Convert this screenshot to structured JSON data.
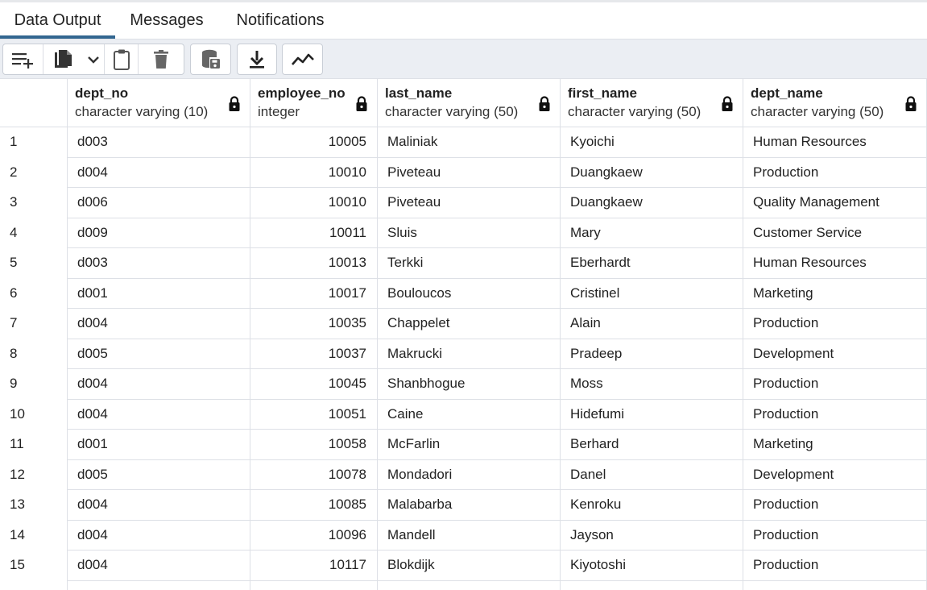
{
  "tabs": [
    {
      "label": "Data Output",
      "active": true
    },
    {
      "label": "Messages",
      "active": false
    },
    {
      "label": "Notifications",
      "active": false
    }
  ],
  "toolbar": {
    "buttons": [
      {
        "icon": "add-row-icon"
      },
      {
        "icon": "copy-icon"
      },
      {
        "icon": "chevron-down-icon"
      },
      {
        "icon": "paste-icon"
      },
      {
        "icon": "delete-icon"
      },
      {
        "icon": "save-data-icon"
      },
      {
        "icon": "download-icon"
      },
      {
        "icon": "graph-icon"
      }
    ],
    "accent_color": "#326690"
  },
  "columns": [
    {
      "name": "dept_no",
      "type": "character varying (10)"
    },
    {
      "name": "employee_no",
      "type": "integer"
    },
    {
      "name": "last_name",
      "type": "character varying (50)"
    },
    {
      "name": "first_name",
      "type": "character varying (50)"
    },
    {
      "name": "dept_name",
      "type": "character varying (50)"
    }
  ],
  "rows": [
    {
      "n": "1",
      "dept_no": "d003",
      "employee_no": "10005",
      "last_name": "Maliniak",
      "first_name": "Kyoichi",
      "dept_name": "Human Resources"
    },
    {
      "n": "2",
      "dept_no": "d004",
      "employee_no": "10010",
      "last_name": "Piveteau",
      "first_name": "Duangkaew",
      "dept_name": "Production"
    },
    {
      "n": "3",
      "dept_no": "d006",
      "employee_no": "10010",
      "last_name": "Piveteau",
      "first_name": "Duangkaew",
      "dept_name": "Quality Management"
    },
    {
      "n": "4",
      "dept_no": "d009",
      "employee_no": "10011",
      "last_name": "Sluis",
      "first_name": "Mary",
      "dept_name": "Customer Service"
    },
    {
      "n": "5",
      "dept_no": "d003",
      "employee_no": "10013",
      "last_name": "Terkki",
      "first_name": "Eberhardt",
      "dept_name": "Human Resources"
    },
    {
      "n": "6",
      "dept_no": "d001",
      "employee_no": "10017",
      "last_name": "Bouloucos",
      "first_name": "Cristinel",
      "dept_name": "Marketing"
    },
    {
      "n": "7",
      "dept_no": "d004",
      "employee_no": "10035",
      "last_name": "Chappelet",
      "first_name": "Alain",
      "dept_name": "Production"
    },
    {
      "n": "8",
      "dept_no": "d005",
      "employee_no": "10037",
      "last_name": "Makrucki",
      "first_name": "Pradeep",
      "dept_name": "Development"
    },
    {
      "n": "9",
      "dept_no": "d004",
      "employee_no": "10045",
      "last_name": "Shanbhogue",
      "first_name": "Moss",
      "dept_name": "Production"
    },
    {
      "n": "10",
      "dept_no": "d004",
      "employee_no": "10051",
      "last_name": "Caine",
      "first_name": "Hidefumi",
      "dept_name": "Production"
    },
    {
      "n": "11",
      "dept_no": "d001",
      "employee_no": "10058",
      "last_name": "McFarlin",
      "first_name": "Berhard",
      "dept_name": "Marketing"
    },
    {
      "n": "12",
      "dept_no": "d005",
      "employee_no": "10078",
      "last_name": "Mondadori",
      "first_name": "Danel",
      "dept_name": "Development"
    },
    {
      "n": "13",
      "dept_no": "d004",
      "employee_no": "10085",
      "last_name": "Malabarba",
      "first_name": "Kenroku",
      "dept_name": "Production"
    },
    {
      "n": "14",
      "dept_no": "d004",
      "employee_no": "10096",
      "last_name": "Mandell",
      "first_name": "Jayson",
      "dept_name": "Production"
    },
    {
      "n": "15",
      "dept_no": "d004",
      "employee_no": "10117",
      "last_name": "Blokdijk",
      "first_name": "Kiyotoshi",
      "dept_name": "Production"
    }
  ]
}
